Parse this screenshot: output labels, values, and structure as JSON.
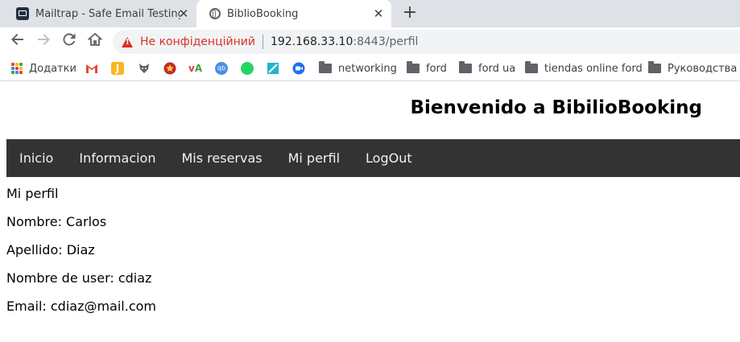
{
  "browser": {
    "tabs": [
      {
        "title": "Mailtrap - Safe Email Testing",
        "icon": "mailtrap-icon",
        "active": false
      },
      {
        "title": "BiblioBooking",
        "icon": "globe-icon",
        "active": true
      }
    ],
    "omnibox": {
      "security_label": "Не конфіденційний",
      "url_host": "192.168.33.10",
      "url_rest": ":8443/perfil"
    },
    "bookmarks": [
      {
        "label": "Додатки",
        "icon": "apps-icon"
      },
      {
        "label": "",
        "icon": "gmail-icon"
      },
      {
        "label": "",
        "icon": "j-icon"
      },
      {
        "label": "",
        "icon": "fox-icon"
      },
      {
        "label": "",
        "icon": "star-icon"
      },
      {
        "label": "",
        "icon": "va-icon"
      },
      {
        "label": "",
        "icon": "qb-icon"
      },
      {
        "label": "",
        "icon": "whatsapp-icon"
      },
      {
        "label": "",
        "icon": "tilda-icon"
      },
      {
        "label": "",
        "icon": "duo-icon"
      },
      {
        "label": "networking",
        "icon": "folder-icon"
      },
      {
        "label": "ford",
        "icon": "folder-icon"
      },
      {
        "label": "ford ua",
        "icon": "folder-icon"
      },
      {
        "label": "tiendas online ford",
        "icon": "folder-icon"
      },
      {
        "label": "Руководства it",
        "icon": "folder-icon"
      }
    ]
  },
  "page": {
    "title": "Bienvenido a BibilioBooking",
    "nav": [
      "Inicio",
      "Informacion",
      "Mis reservas",
      "Mi perfil",
      "LogOut"
    ],
    "section_title": "Mi perfil",
    "fields": [
      "Nombre: Carlos",
      "Apellido: Diaz",
      "Nombre de user: cdiaz",
      "Email: cdiaz@mail.com"
    ]
  },
  "colors": {
    "nav_bg": "#333333",
    "nav_text": "#f2f2f2",
    "warning_red": "#d93025"
  }
}
